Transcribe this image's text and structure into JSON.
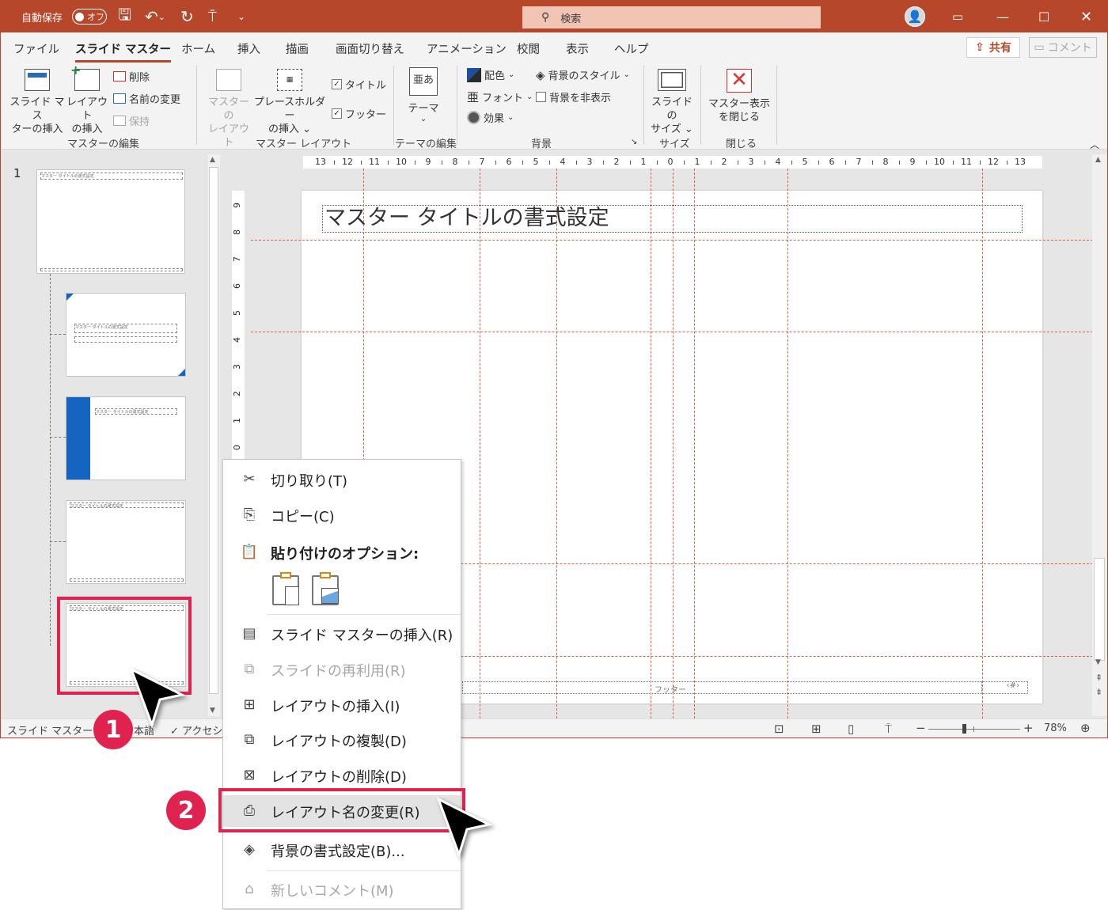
{
  "titlebar": {
    "autosave_label": "自動保存",
    "autosave_state": "オフ",
    "search_placeholder": "検索"
  },
  "tabs": [
    "ファイル",
    "スライド マスター",
    "ホーム",
    "挿入",
    "描画",
    "画面切り替え",
    "アニメーション",
    "校閲",
    "表示",
    "ヘルプ"
  ],
  "share_label": "共有",
  "comment_label": "コメント",
  "ribbon": {
    "insert_master": "スライド マス\nターの挿入",
    "insert_layout": "レイアウト\nの挿入",
    "delete": "削除",
    "rename": "名前の変更",
    "preserve": "保持",
    "group_master_edit": "マスターの編集",
    "master_layout": "マスターの\nレイアウト",
    "insert_placeholder": "プレースホルダー\nの挿入 ⌄",
    "title_check": "タイトル",
    "footer_check": "フッター",
    "group_master_layout": "マスター レイアウト",
    "themes": "テーマ",
    "group_theme_edit": "テーマの編集",
    "colors": "配色",
    "fonts": "フォント",
    "effects": "効果",
    "bg_styles": "背景のスタイル",
    "hide_bg": "背景を非表示",
    "group_background": "背景",
    "slide_size": "スライドの\nサイズ ⌄",
    "group_size": "サイズ",
    "close_master": "マスター表示\nを閉じる",
    "group_close": "閉じる"
  },
  "thumbs": {
    "number": "1",
    "title_text": "マスター タイトルの書式設定"
  },
  "ruler_labels": [
    "13",
    "12",
    "11",
    "10",
    "9",
    "8",
    "7",
    "6",
    "5",
    "4",
    "3",
    "2",
    "1",
    "0",
    "1",
    "2",
    "3",
    "4",
    "5",
    "6",
    "7",
    "8",
    "9",
    "10",
    "11",
    "12",
    "13"
  ],
  "vruler_labels": [
    "9",
    "8",
    "7",
    "6",
    "5",
    "4",
    "3",
    "2",
    "1",
    "0"
  ],
  "slide": {
    "title": "マスター タイトルの書式設定",
    "footer": "フッター",
    "page_num": "‹#›"
  },
  "statusbar": {
    "view": "スライド マスター",
    "lang": "本語",
    "access": "アクセシ",
    "zoom": "78%"
  },
  "context_menu": [
    {
      "label": "切り取り(T)",
      "icon": "✂",
      "disabled": false
    },
    {
      "label": "コピー(C)",
      "icon": "⎘",
      "disabled": false
    },
    {
      "label": "貼り付けのオプション:",
      "icon": "📋",
      "disabled": false
    },
    {
      "label": "スライド マスターの挿入(R)",
      "icon": "▤",
      "disabled": false
    },
    {
      "label": "スライドの再利用(R)",
      "icon": "⧉",
      "disabled": true
    },
    {
      "label": "レイアウトの挿入(I)",
      "icon": "⊞",
      "disabled": false
    },
    {
      "label": "レイアウトの複製(D)",
      "icon": "⧉",
      "disabled": false
    },
    {
      "label": "レイアウトの削除(D)",
      "icon": "⊠",
      "disabled": false
    },
    {
      "label": "レイアウト名の変更(R)",
      "icon": "⎙",
      "disabled": false
    },
    {
      "label": "背景の書式設定(B)...",
      "icon": "◈",
      "disabled": false
    },
    {
      "label": "新しいコメント(M)",
      "icon": "⌂",
      "disabled": true
    }
  ],
  "badges": [
    "1",
    "2"
  ],
  "colors": {
    "accent": "#b7472a",
    "highlight": "#e0224e",
    "guides": "#e8603c",
    "blue": "#1565c0"
  }
}
